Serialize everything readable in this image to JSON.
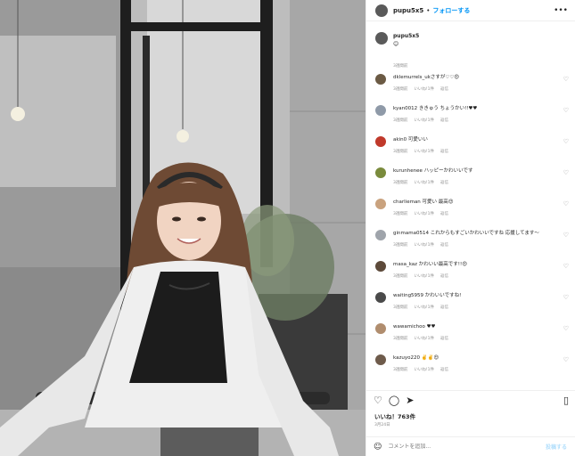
{
  "header": {
    "username": "pupu5x5",
    "separator": "•",
    "follow_label": "フォローする",
    "more_icon": "more-horizontal-icon"
  },
  "caption": {
    "username": "pupu5x5",
    "text": "😊",
    "time": "3週間前"
  },
  "comments": [
    {
      "user": "dklemurrels",
      "text": "dklemurrels_ukさすが♡♡😍",
      "meta": [
        "3週間前",
        "いいね!1件",
        "返信"
      ],
      "avatar_color": "#6b5a44"
    },
    {
      "user": "kyan0012",
      "text": "kyan0012 ききゅう ちょうかい!!♥♥",
      "meta": [
        "3週間前",
        "いいね!1件",
        "返信"
      ],
      "avatar_color": "#8f9aa8"
    },
    {
      "user": "akin0",
      "text": "akin0 可愛いい",
      "meta": [
        "3週間前",
        "いいね!1件",
        "返信"
      ],
      "avatar_color": "#c0392b"
    },
    {
      "user": "kurunhenee",
      "text": "kurunhenee ハッピーかわいいです",
      "meta": [
        "3週間前",
        "いいね!1件",
        "返信"
      ],
      "avatar_color": "#7a8b3c"
    },
    {
      "user": "charlieman",
      "text": "charlieman 可愛い 最高😍",
      "meta": [
        "3週間前",
        "いいね!1件",
        "返信"
      ],
      "avatar_color": "#c9a27e"
    },
    {
      "user": "ginmama",
      "text": "ginmama0514 これからもすごいかわいいですね 応援してます〜",
      "meta": [
        "3週間前",
        "いいね!1件",
        "返信"
      ],
      "avatar_color": "#9fa4ab"
    },
    {
      "user": "masa_kaz",
      "text": "masa_kaz かわいい最高です!!😍",
      "meta": [
        "3週間前",
        "いいね!1件",
        "返信"
      ],
      "avatar_color": "#5d4a3a"
    },
    {
      "user": "waiting",
      "text": "waiting5959 かわいいですね!",
      "meta": [
        "3週間前",
        "いいね!1件",
        "返信"
      ],
      "avatar_color": "#4a4a4a"
    },
    {
      "user": "wawamicho",
      "text": "wawamichoo ♥♥",
      "meta": [
        "3週間前",
        "いいね!1件",
        "返信"
      ],
      "avatar_color": "#b08d6e"
    },
    {
      "user": "kazuyo",
      "text": "kazuyo220 ✌️✌️😍",
      "meta": [
        "3週間前",
        "いいね!1件",
        "返信"
      ],
      "avatar_color": "#6e5b4b"
    }
  ],
  "actions": {
    "like_icon": "heart-icon",
    "comment_icon": "comment-icon",
    "share_icon": "share-icon",
    "save_icon": "bookmark-icon",
    "likes": "いいね！763件",
    "time": "3月24日"
  },
  "add_comment": {
    "placeholder": "コメントを追加...",
    "post_label": "投稿する"
  },
  "colors": {
    "link": "#0095f6",
    "muted": "#8e8e8e",
    "post_disabled": "#b2dffc"
  }
}
